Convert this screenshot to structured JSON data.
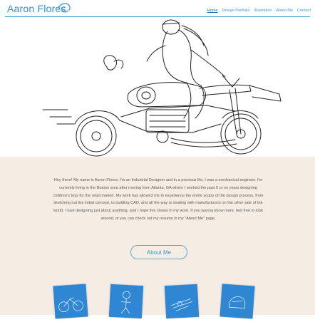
{
  "header": {
    "logo": "Aaron Flores",
    "nav": [
      "Home",
      "Design Portfolio",
      "Illustration",
      "About Me",
      "Contact"
    ],
    "active": "Home"
  },
  "hero": {
    "icon": "motorcycle-rider-illustration"
  },
  "about": {
    "bio": "Hey there! My name is Aaron Flores, I'm an Industrial Designer and in a previous life, I was a mechanical engineer. I'm currently living in the Boston area after moving from Atlanta, GA where I worked the past 5 or so years designing children's toys for the retail market. My work has allowed me to experience the entire scope of the design process, from sketching out the initial concept, to building CAD, and all the way to dealing with manufacturers on the other side of the world. I love designing just about anything, and I hope this shows in my work. If you wanna know more, feel free to look around, or you can check out my resume in my \"About Me\" page.",
    "button": "About Me"
  },
  "thumbnails": [
    {
      "icon": "bicycle-sketch-icon"
    },
    {
      "icon": "figure-sketch-icon"
    },
    {
      "icon": "tools-sketch-icon"
    },
    {
      "icon": "helmet-sketch-icon"
    }
  ],
  "colors": {
    "accent": "#3a9ad6",
    "about_bg": "#f5ede3",
    "thumb_bg": "#2f86d2"
  }
}
